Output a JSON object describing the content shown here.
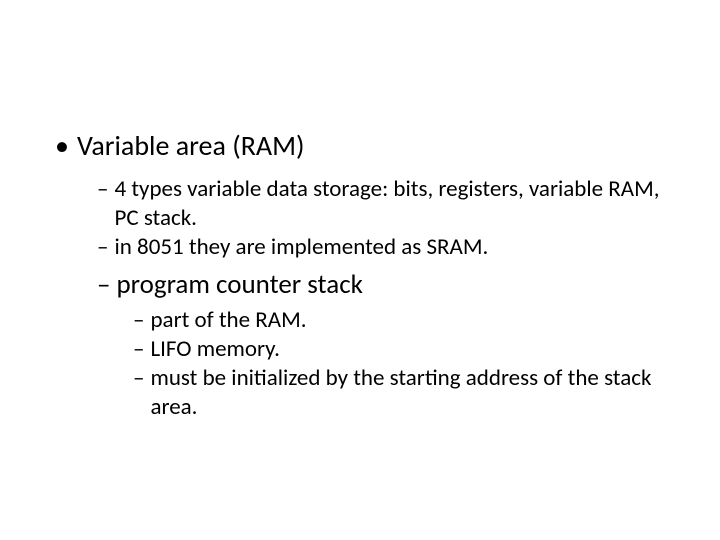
{
  "slide": {
    "l1": "Variable area (RAM)",
    "l2a": "4 types variable data storage: bits, registers, variable RAM,  PC stack.",
    "l2b": "in 8051 they are implemented as SRAM.",
    "l2c": "program counter stack",
    "l3a": "part of the RAM.",
    "l3b": "LIFO memory.",
    "l3c": "must be initialized by the starting address of the stack area."
  }
}
